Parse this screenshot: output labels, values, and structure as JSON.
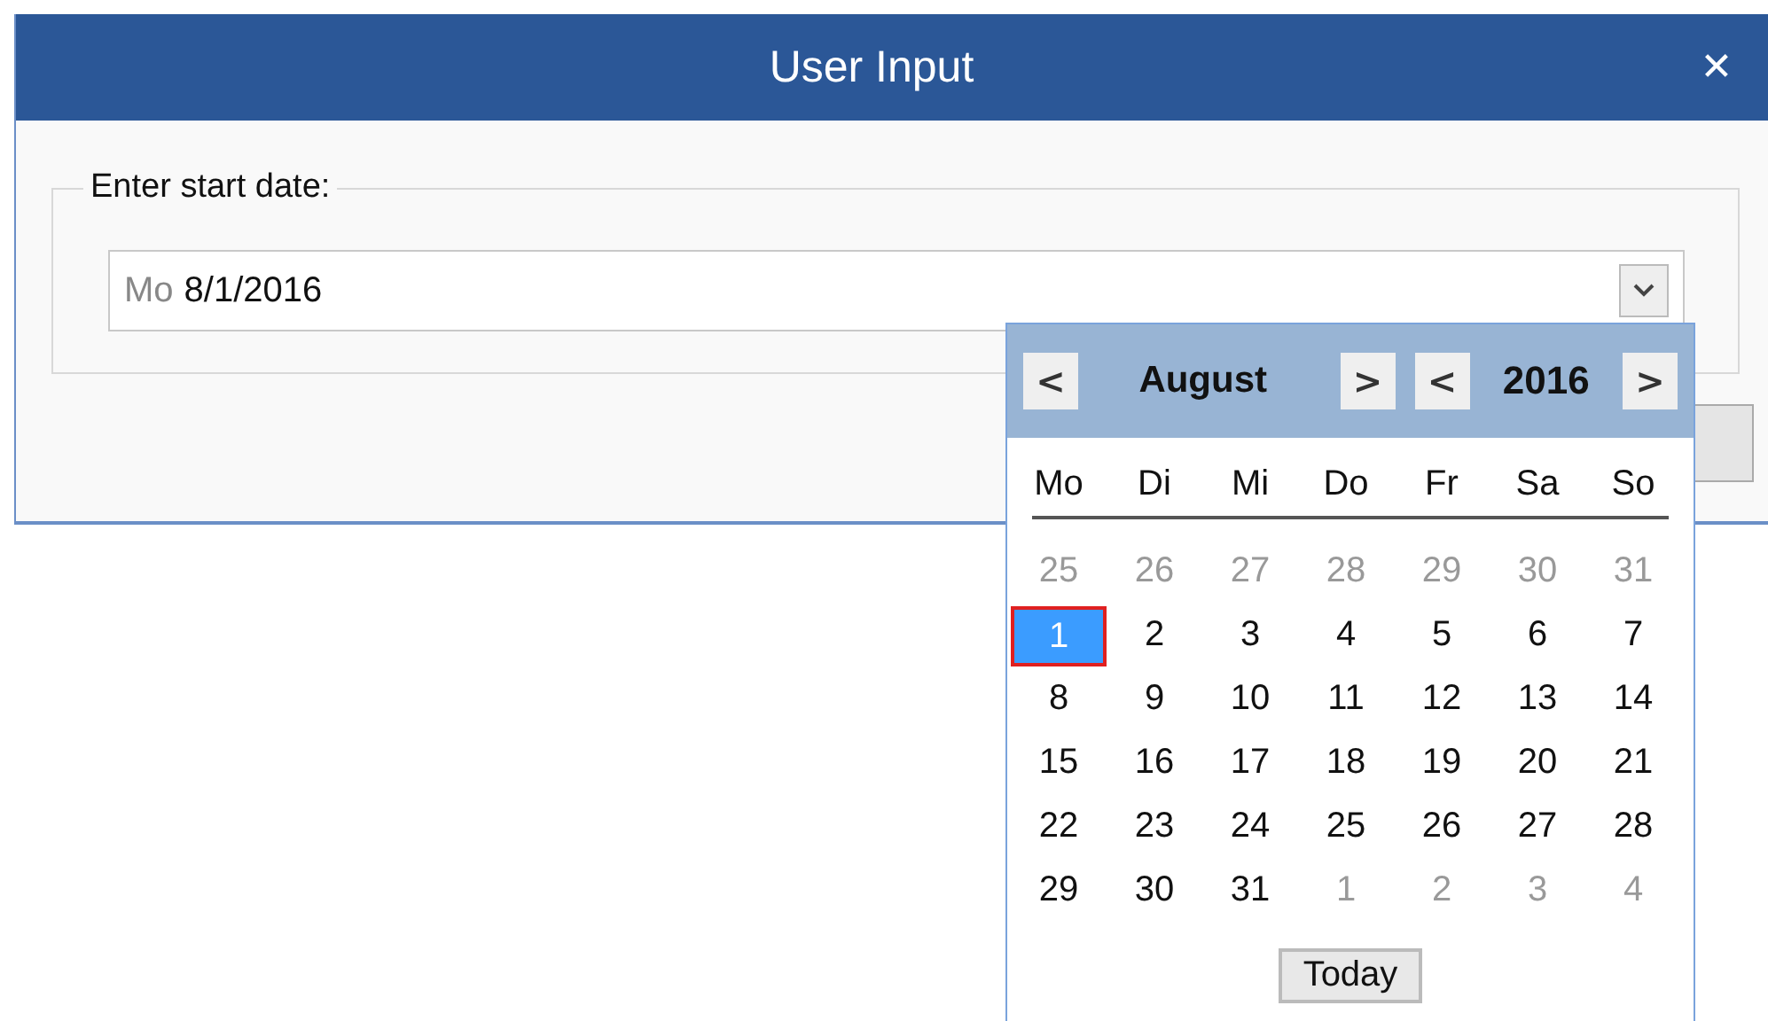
{
  "window": {
    "title": "User Input",
    "close": "✕"
  },
  "group": {
    "label": "Enter start date:"
  },
  "date_field": {
    "weekday": "Mo",
    "value": "8/1/2016"
  },
  "calendar": {
    "prev_month": "<",
    "month": "August",
    "next_month": ">",
    "prev_year": "<",
    "year": "2016",
    "next_year": ">",
    "weekdays": [
      "Mo",
      "Di",
      "Mi",
      "Do",
      "Fr",
      "Sa",
      "So"
    ],
    "days": [
      {
        "label": "25",
        "other_month": true,
        "selected": false
      },
      {
        "label": "26",
        "other_month": true,
        "selected": false
      },
      {
        "label": "27",
        "other_month": true,
        "selected": false
      },
      {
        "label": "28",
        "other_month": true,
        "selected": false
      },
      {
        "label": "29",
        "other_month": true,
        "selected": false
      },
      {
        "label": "30",
        "other_month": true,
        "selected": false
      },
      {
        "label": "31",
        "other_month": true,
        "selected": false
      },
      {
        "label": "1",
        "other_month": false,
        "selected": true
      },
      {
        "label": "2",
        "other_month": false,
        "selected": false
      },
      {
        "label": "3",
        "other_month": false,
        "selected": false
      },
      {
        "label": "4",
        "other_month": false,
        "selected": false
      },
      {
        "label": "5",
        "other_month": false,
        "selected": false
      },
      {
        "label": "6",
        "other_month": false,
        "selected": false
      },
      {
        "label": "7",
        "other_month": false,
        "selected": false
      },
      {
        "label": "8",
        "other_month": false,
        "selected": false
      },
      {
        "label": "9",
        "other_month": false,
        "selected": false
      },
      {
        "label": "10",
        "other_month": false,
        "selected": false
      },
      {
        "label": "11",
        "other_month": false,
        "selected": false
      },
      {
        "label": "12",
        "other_month": false,
        "selected": false
      },
      {
        "label": "13",
        "other_month": false,
        "selected": false
      },
      {
        "label": "14",
        "other_month": false,
        "selected": false
      },
      {
        "label": "15",
        "other_month": false,
        "selected": false
      },
      {
        "label": "16",
        "other_month": false,
        "selected": false
      },
      {
        "label": "17",
        "other_month": false,
        "selected": false
      },
      {
        "label": "18",
        "other_month": false,
        "selected": false
      },
      {
        "label": "19",
        "other_month": false,
        "selected": false
      },
      {
        "label": "20",
        "other_month": false,
        "selected": false
      },
      {
        "label": "21",
        "other_month": false,
        "selected": false
      },
      {
        "label": "22",
        "other_month": false,
        "selected": false
      },
      {
        "label": "23",
        "other_month": false,
        "selected": false
      },
      {
        "label": "24",
        "other_month": false,
        "selected": false
      },
      {
        "label": "25",
        "other_month": false,
        "selected": false
      },
      {
        "label": "26",
        "other_month": false,
        "selected": false
      },
      {
        "label": "27",
        "other_month": false,
        "selected": false
      },
      {
        "label": "28",
        "other_month": false,
        "selected": false
      },
      {
        "label": "29",
        "other_month": false,
        "selected": false
      },
      {
        "label": "30",
        "other_month": false,
        "selected": false
      },
      {
        "label": "31",
        "other_month": false,
        "selected": false
      },
      {
        "label": "1",
        "other_month": true,
        "selected": false
      },
      {
        "label": "2",
        "other_month": true,
        "selected": false
      },
      {
        "label": "3",
        "other_month": true,
        "selected": false
      },
      {
        "label": "4",
        "other_month": true,
        "selected": false
      }
    ],
    "today_button": "Today"
  }
}
